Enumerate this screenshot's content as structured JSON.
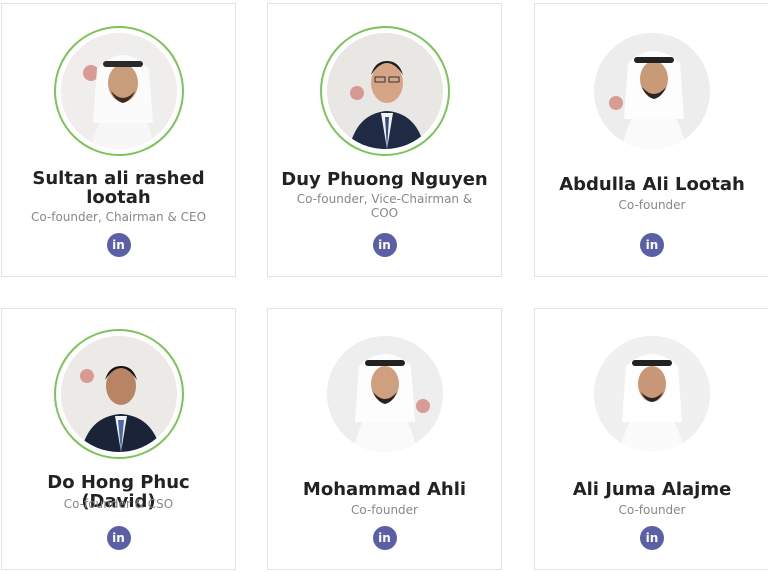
{
  "team": [
    {
      "name": "Sultan ali rashed lootah",
      "role": "Co-founder, Chairman & CEO",
      "linkedin_label": "in"
    },
    {
      "name": "Duy Phuong Nguyen",
      "role": "Co-founder, Vice-Chairman & COO",
      "linkedin_label": "in"
    },
    {
      "name": "Abdulla Ali Lootah",
      "role": "Co-founder",
      "linkedin_label": "in"
    },
    {
      "name": "Do Hong Phuc (David)",
      "role": "Co-founder & CSO",
      "linkedin_label": "in"
    },
    {
      "name": "Mohammad Ahli",
      "role": "Co-founder",
      "linkedin_label": "in"
    },
    {
      "name": "Ali Juma Alajme",
      "role": "Co-founder",
      "linkedin_label": "in"
    }
  ],
  "colors": {
    "linkedin": "#5a5fa6",
    "ring": "#7cc35a"
  },
  "icons": {
    "linkedin": "linkedin-icon"
  }
}
